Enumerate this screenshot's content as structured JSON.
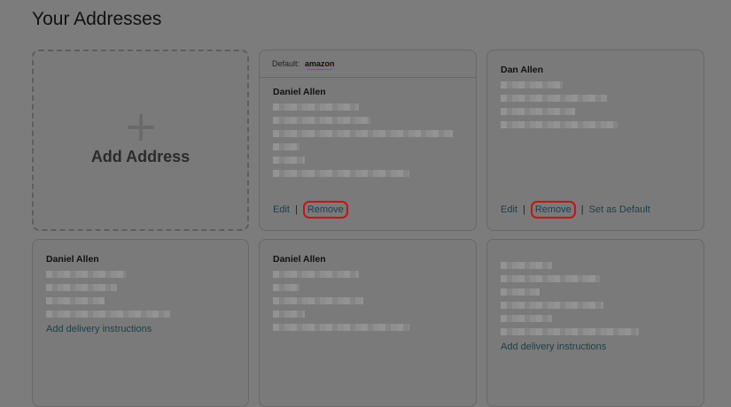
{
  "page": {
    "title": "Your Addresses"
  },
  "add_card": {
    "label": "Add Address"
  },
  "cards": [
    {
      "default_label": "Default:",
      "default_brand": "amazon",
      "name": "Daniel Allen",
      "edit": "Edit",
      "sep": "|",
      "remove": "Remove"
    },
    {
      "name": "Dan Allen",
      "edit": "Edit",
      "sep": "|",
      "remove": "Remove",
      "sep2": "|",
      "set_default": "Set as Default"
    },
    {
      "name": "Daniel Allen",
      "instructions": "Add delivery instructions"
    },
    {
      "name": "Daniel Allen"
    },
    {
      "instructions": "Add delivery instructions"
    }
  ]
}
